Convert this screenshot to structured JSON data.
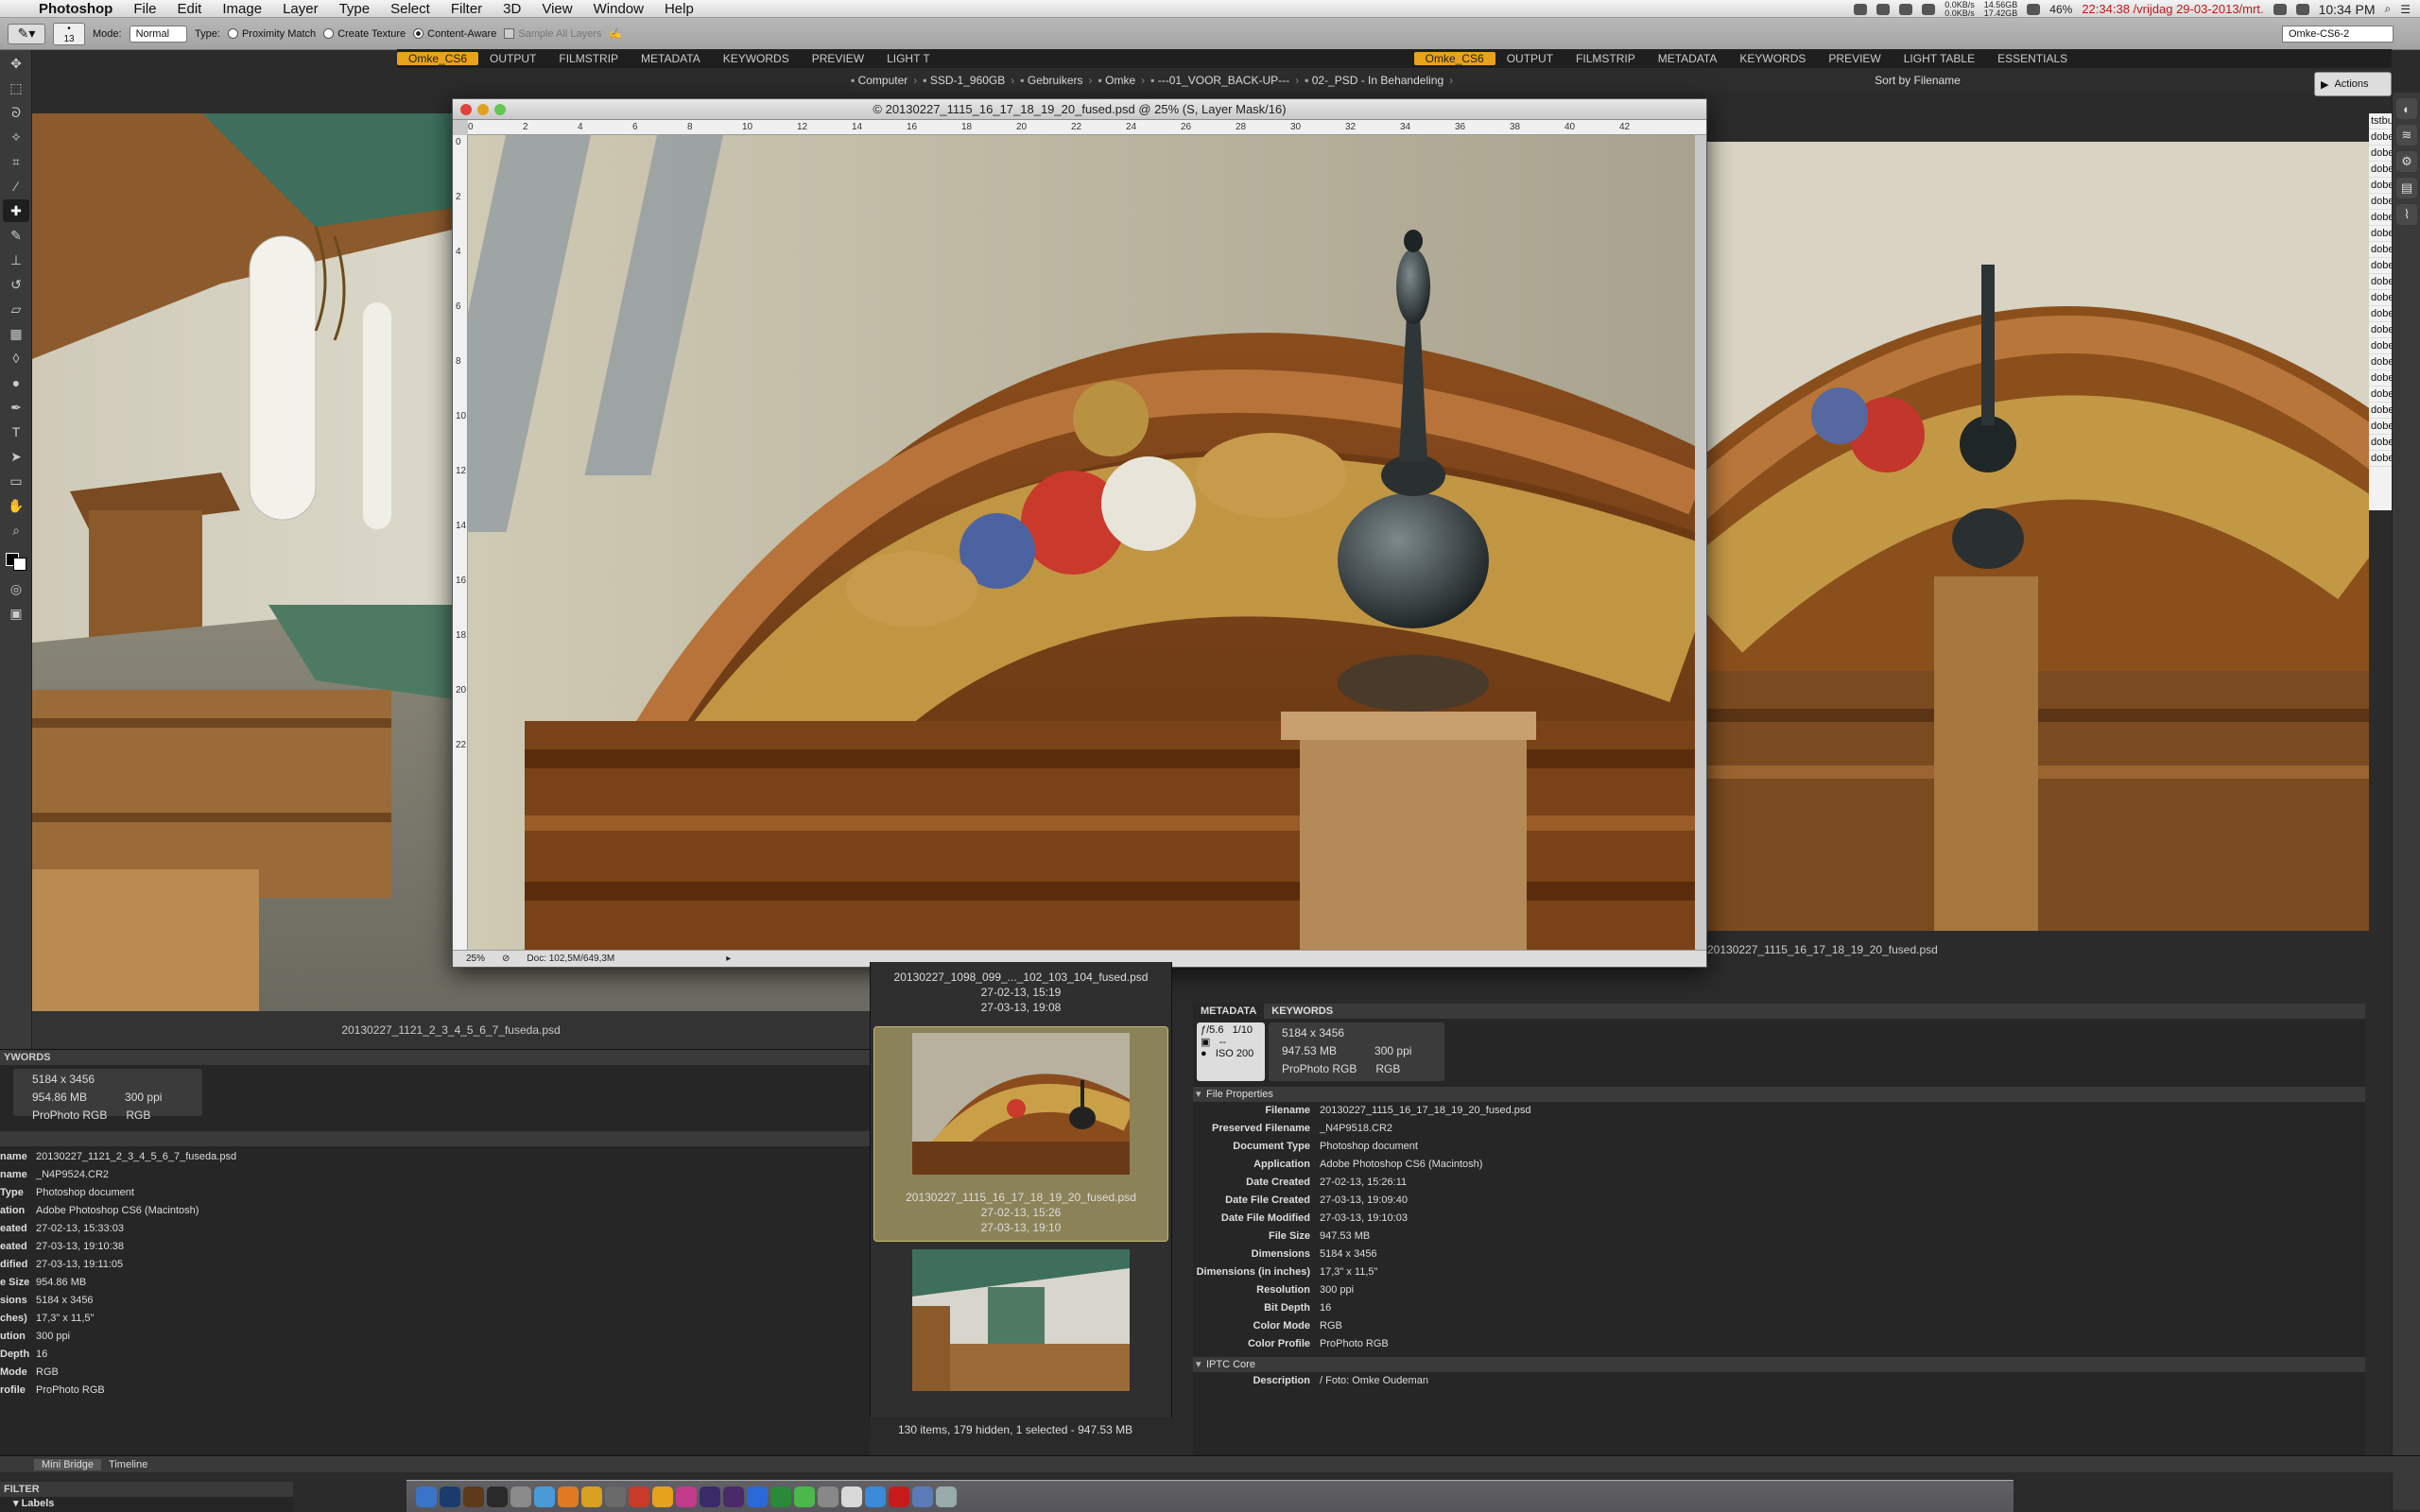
{
  "menubar": {
    "app_name": "Photoshop",
    "items": [
      "File",
      "Edit",
      "Image",
      "Layer",
      "Type",
      "Select",
      "Filter",
      "3D",
      "View",
      "Window",
      "Help"
    ],
    "battery": "46%",
    "net_up": "0.0KB/s",
    "net_down": "0.0KB/s",
    "disk_used": "14.56GB",
    "disk_free": "17.42GB",
    "clock_red": "22:34:38 /vrijdag 29-03-2013/mrt.",
    "clock": "10:34 PM"
  },
  "options_bar": {
    "brush_size": "13",
    "mode_label": "Mode:",
    "mode_value": "Normal",
    "type_label": "Type:",
    "proximity_match": "Proximity Match",
    "create_texture": "Create Texture",
    "content_aware": "Content-Aware",
    "sample_all_layers": "Sample All Layers",
    "workspace": "Omke-CS6-2"
  },
  "bridge": {
    "workspace_tabs": [
      "Omke_CS6",
      "OUTPUT",
      "FILMSTRIP",
      "METADATA",
      "KEYWORDS",
      "PREVIEW",
      "LIGHT T"
    ],
    "workspace_tabs_right": [
      "Omke_CS6",
      "OUTPUT",
      "FILMSTRIP",
      "METADATA",
      "KEYWORDS",
      "PREVIEW",
      "LIGHT TABLE",
      "ESSENTIALS"
    ],
    "path": [
      "Computer",
      "SSD-1_960GB",
      "Gebruikers",
      "Omke",
      "---01_VOOR_BACK-UP---",
      "02-_PSD - In Behandeling"
    ],
    "sort_label": "Sort by Filename",
    "actions_label": "Actions",
    "left_caption": "20130227_1121_2_3_4_5_6_7_fuseda.psd",
    "right_caption": "20130227_1115_16_17_18_19_20_fused.psd",
    "status": "130 items, 179 hidden, 1 selected - 947.53 MB"
  },
  "document": {
    "title": "© 20130227_1115_16_17_18_19_20_fused.psd @ 25% (S, Layer Mask/16)",
    "zoom": "25%",
    "doc_size": "Doc: 102,5M/649,3M",
    "ruler_h": [
      "0",
      "2",
      "4",
      "6",
      "8",
      "10",
      "12",
      "14",
      "16",
      "18",
      "20",
      "22",
      "24",
      "26",
      "28",
      "30",
      "32",
      "34",
      "36",
      "38",
      "40",
      "42"
    ],
    "ruler_v": [
      "0",
      "2",
      "4",
      "6",
      "8",
      "10",
      "12",
      "14",
      "16",
      "18",
      "20",
      "22"
    ]
  },
  "thumbnails": [
    {
      "name": "20130227_1098_099_..._102_103_104_fused.psd",
      "created": "27-02-13, 15:19",
      "modified": "27-03-13, 19:08"
    },
    {
      "name": "20130227_1115_16_17_18_19_20_fused.psd",
      "created": "27-02-13, 15:26",
      "modified": "27-03-13, 19:10"
    }
  ],
  "left_meta": {
    "tab": "YWORDS",
    "summary": {
      "dims": "5184 x 3456",
      "size": "954.86 MB",
      "res": "300 ppi",
      "profile": "ProPhoto RGB",
      "mode": "RGB"
    },
    "rows": [
      {
        "k": "name",
        "v": "20130227_1121_2_3_4_5_6_7_fuseda.psd"
      },
      {
        "k": "name",
        "v": "_N4P9524.CR2"
      },
      {
        "k": "Type",
        "v": "Photoshop document"
      },
      {
        "k": "ation",
        "v": "Adobe Photoshop CS6 (Macintosh)"
      },
      {
        "k": "eated",
        "v": "27-02-13, 15:33:03"
      },
      {
        "k": "eated",
        "v": "27-03-13, 19:10:38"
      },
      {
        "k": "dified",
        "v": "27-03-13, 19:11:05"
      },
      {
        "k": "e Size",
        "v": "954.86 MB"
      },
      {
        "k": "sions",
        "v": "5184 x 3456"
      },
      {
        "k": "ches)",
        "v": "17,3\" x 11,5\""
      },
      {
        "k": "ution",
        "v": "300 ppi"
      },
      {
        "k": "Depth",
        "v": "16"
      },
      {
        "k": "Mode",
        "v": "RGB"
      },
      {
        "k": "rofile",
        "v": "ProPhoto RGB"
      }
    ]
  },
  "right_meta": {
    "tabs": [
      "METADATA",
      "KEYWORDS"
    ],
    "exif": {
      "aperture": "ƒ/5.6",
      "shutter": "1/10",
      "dash": "--",
      "iso": "ISO 200"
    },
    "summary": {
      "dims": "5184 x 3456",
      "size": "947.53 MB",
      "res": "300 ppi",
      "profile": "ProPhoto RGB",
      "mode": "RGB"
    },
    "file_props_label": "File Properties",
    "rows": [
      {
        "k": "Filename",
        "v": "20130227_1115_16_17_18_19_20_fused.psd"
      },
      {
        "k": "Preserved Filename",
        "v": "_N4P9518.CR2"
      },
      {
        "k": "Document Type",
        "v": "Photoshop document"
      },
      {
        "k": "Application",
        "v": "Adobe Photoshop CS6 (Macintosh)"
      },
      {
        "k": "Date Created",
        "v": "27-02-13, 15:26:11"
      },
      {
        "k": "Date File Created",
        "v": "27-03-13, 19:09:40"
      },
      {
        "k": "Date File Modified",
        "v": "27-03-13, 19:10:03"
      },
      {
        "k": "File Size",
        "v": "947.53 MB"
      },
      {
        "k": "Dimensions",
        "v": "5184 x 3456"
      },
      {
        "k": "Dimensions (in inches)",
        "v": "17,3\" x 11,5\""
      },
      {
        "k": "Resolution",
        "v": "300 ppi"
      },
      {
        "k": "Bit Depth",
        "v": "16"
      },
      {
        "k": "Color Mode",
        "v": "RGB"
      },
      {
        "k": "Color Profile",
        "v": "ProPhoto RGB"
      }
    ],
    "iptc_label": "IPTC Core",
    "description_label": "Description",
    "description": "/ Foto: Omke Oudeman"
  },
  "bottom": {
    "tabs": [
      "Mini Bridge",
      "Timeline"
    ],
    "filter_label": "FILTER",
    "labels_label": "Labels"
  },
  "right_strip": [
    "tstbu",
    "dobe",
    "dobe",
    "dobe",
    "dobe",
    "dobe",
    "dobe",
    "dobe",
    "dobe",
    "dobe",
    "dobe",
    "dobe",
    "dobe",
    "dobe",
    "dobe",
    "dobe",
    "dobe",
    "dobe",
    "dobe",
    "dobe",
    "dobe",
    "dobe"
  ]
}
